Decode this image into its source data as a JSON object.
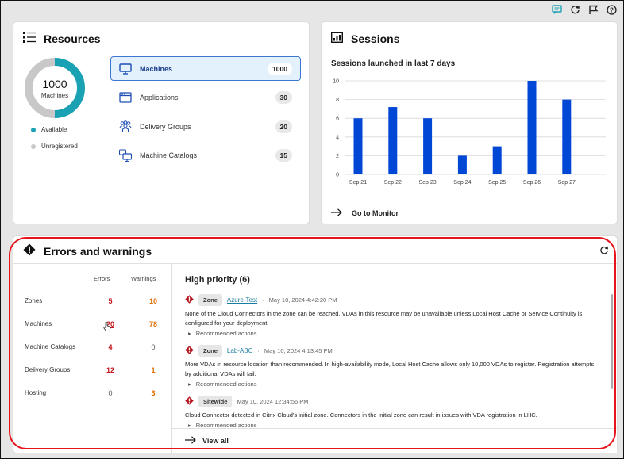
{
  "topbar": {
    "icons": [
      "chat-icon",
      "refresh-icon",
      "flag-icon",
      "help-icon"
    ]
  },
  "resources": {
    "title": "Resources",
    "donut": {
      "total": "1000",
      "label": "Machines",
      "segments": [
        {
          "name": "Available",
          "fraction": 0.5,
          "color": "#1ba1b4"
        },
        {
          "name": "Unregistered",
          "fraction": 0.5,
          "color": "#c8c8c8"
        }
      ]
    },
    "legend": [
      {
        "label": "Available",
        "color": "#1ba1b4"
      },
      {
        "label": "Unregistered",
        "color": "#c8c8c8"
      }
    ],
    "items": [
      {
        "label": "Machines",
        "count": "1000",
        "icon": "monitor-icon",
        "active": true
      },
      {
        "label": "Applications",
        "count": "30",
        "icon": "app-window-icon",
        "active": false
      },
      {
        "label": "Delivery Groups",
        "count": "20",
        "icon": "users-group-icon",
        "active": false
      },
      {
        "label": "Machine Catalogs",
        "count": "15",
        "icon": "machine-catalog-icon",
        "active": false
      }
    ]
  },
  "sessions": {
    "title": "Sessions",
    "link": "Go to Monitor"
  },
  "chart_data": {
    "type": "bar",
    "title": "Sessions launched in last 7 days",
    "categories": [
      "Sep 21",
      "Sep 22",
      "Sep 23",
      "Sep 24",
      "Sep 25",
      "Sep 26",
      "Sep 27"
    ],
    "values": [
      6,
      7.2,
      6,
      2,
      3,
      10,
      8
    ],
    "xlabel": "",
    "ylabel": "",
    "ylim": [
      0,
      10
    ],
    "yticks": [
      0,
      2,
      4,
      6,
      8,
      10
    ],
    "grid": true,
    "bar_color": "#0047d6"
  },
  "errors": {
    "title": "Errors and warnings",
    "columns": {
      "errors": "Errors",
      "warnings": "Warnings"
    },
    "rows": [
      {
        "name": "Zones",
        "errors": "5",
        "warnings": "10"
      },
      {
        "name": "Machines",
        "errors": "20",
        "warnings": "78"
      },
      {
        "name": "Machine Catalogs",
        "errors": "4",
        "warnings": "0"
      },
      {
        "name": "Delivery Groups",
        "errors": "12",
        "warnings": "1"
      },
      {
        "name": "Hosting",
        "errors": "0",
        "warnings": "3"
      }
    ],
    "priority_title": "High priority (6)",
    "alerts": [
      {
        "scope": "Zone",
        "resource": "Azure-Test",
        "timestamp": "May 10, 2024 4:42:20 PM",
        "description": "None of the Cloud Connectors in the zone can be reached. VDAs in this resource may be unavailable unless Local Host Cache or Service Continuity is configured for your deployment.",
        "action": "Recommended actions"
      },
      {
        "scope": "Zone",
        "resource": "Lab-ABC",
        "timestamp": "May 10, 2024 4:13:45 PM",
        "description": "More VDAs in resource location than recommended. In high-availability mode, Local Host Cache allows only 10,000 VDAs to register. Registration attempts by additional VDAs will fail.",
        "action": "Recommended actions"
      },
      {
        "scope": "Sitewide",
        "resource": "",
        "timestamp": "May 10, 2024 12:34:56 PM",
        "description": "Cloud Connector detected in Citrix Cloud's initial zone. Connectors in the initial zone can result in issues with VDA registration in LHC.",
        "action": "Recommended actions"
      }
    ],
    "view_all": "View all"
  }
}
